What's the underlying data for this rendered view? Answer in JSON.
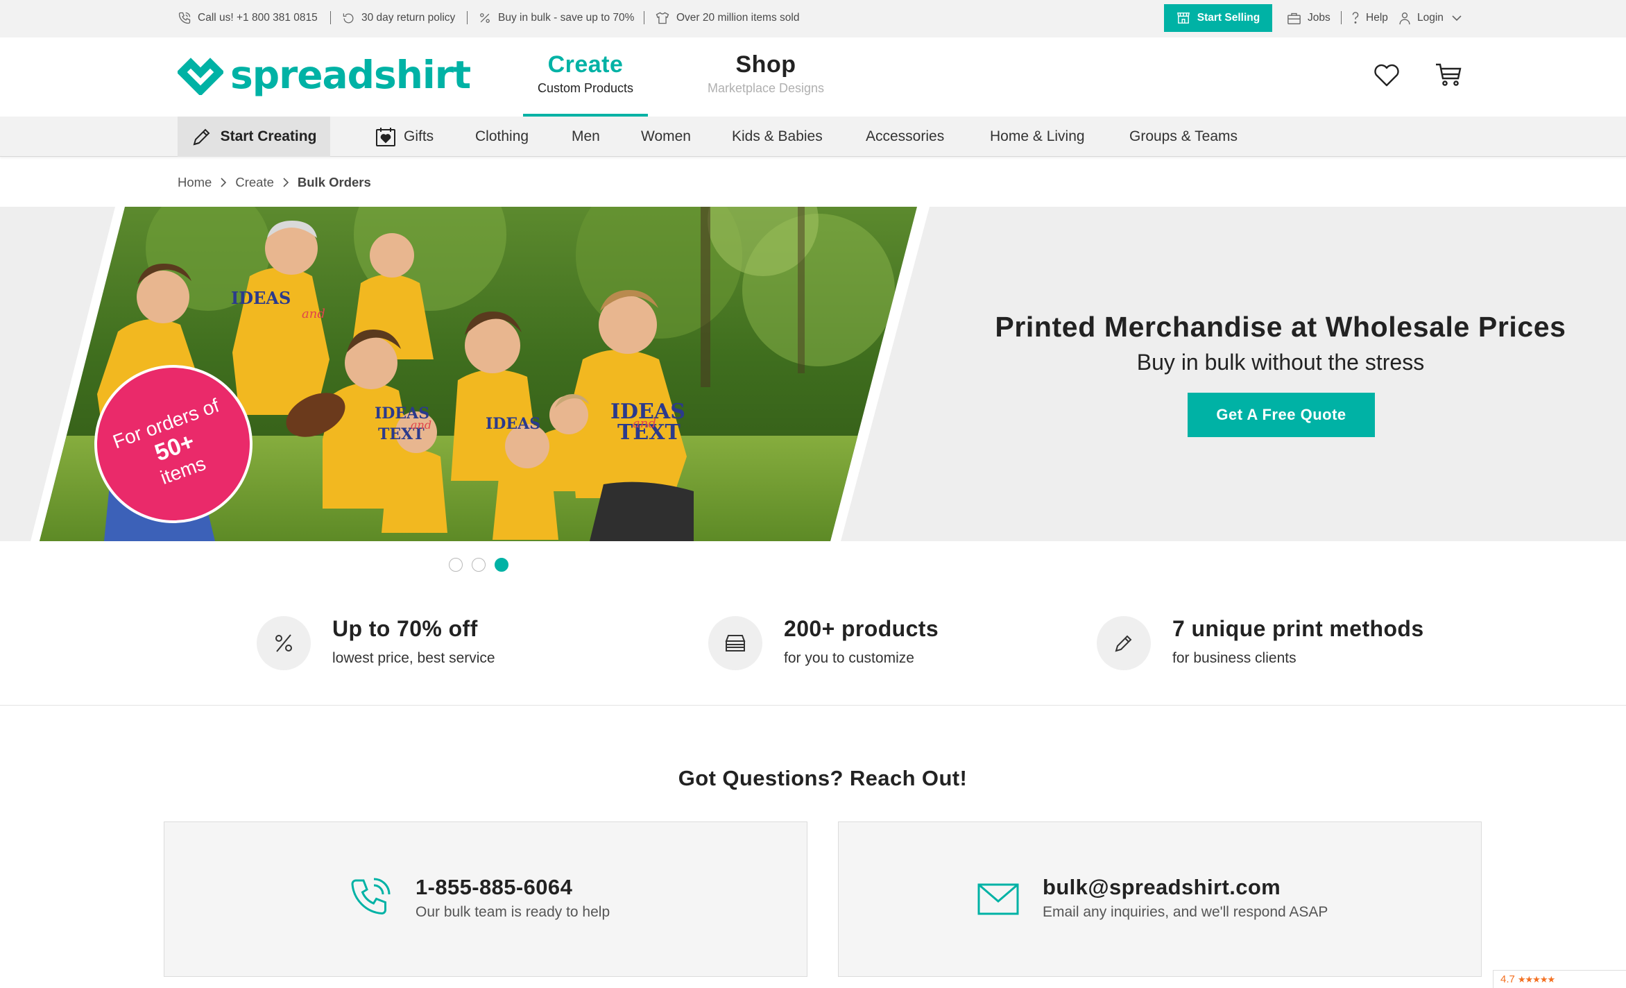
{
  "topbar": {
    "call": "Call us! +1 800 381 0815",
    "returns": "30 day return policy",
    "bulk": "Buy in bulk - save up to 70%",
    "sold": "Over 20 million items sold",
    "sell_button": "Start Selling",
    "jobs": "Jobs",
    "help": "Help",
    "login": "Login"
  },
  "header": {
    "logo_text": "spreadshirt",
    "tabs": [
      {
        "title": "Create",
        "subtitle": "Custom Products"
      },
      {
        "title": "Shop",
        "subtitle": "Marketplace Designs"
      }
    ]
  },
  "nav": {
    "start": "Start Creating",
    "items": [
      "Gifts",
      "Clothing",
      "Men",
      "Women",
      "Kids & Babies",
      "Accessories",
      "Home & Living",
      "Groups & Teams"
    ]
  },
  "breadcrumb": [
    "Home",
    "Create",
    "Bulk Orders"
  ],
  "hero": {
    "title": "Printed Merchandise at Wholesale Prices",
    "subtitle": "Buy in bulk without the stress",
    "button": "Get A Free Quote",
    "badge_line1": "For orders of",
    "badge_line2": "50+",
    "badge_line3": "items",
    "shirt_text_1": "IDEAS",
    "shirt_text_2": "and",
    "shirt_text_3": "TEXT",
    "slides_total": 3,
    "active_slide": 3
  },
  "features": [
    {
      "icon": "percent-icon",
      "title": "Up to 70% off",
      "subtitle": "lowest price, best service"
    },
    {
      "icon": "stack-icon",
      "title": "200+ products",
      "subtitle": "for you to customize"
    },
    {
      "icon": "pencil-icon",
      "title": "7 unique print methods",
      "subtitle": "for business clients"
    }
  ],
  "contact": {
    "title": "Got Questions? Reach Out!",
    "phone": {
      "title": "1-855-885-6064",
      "subtitle": "Our bulk team is ready to help"
    },
    "email": {
      "title": "bulk@spreadshirt.com",
      "subtitle": "Email any inquiries, and we'll respond ASAP"
    }
  },
  "rating": {
    "score": "4.7",
    "stars": "★★★★★"
  },
  "colors": {
    "accent": "#00b2a5",
    "badge": "#ea2a6a",
    "shirt": "#f2b820",
    "shirt_print": "#2b3a8c"
  }
}
